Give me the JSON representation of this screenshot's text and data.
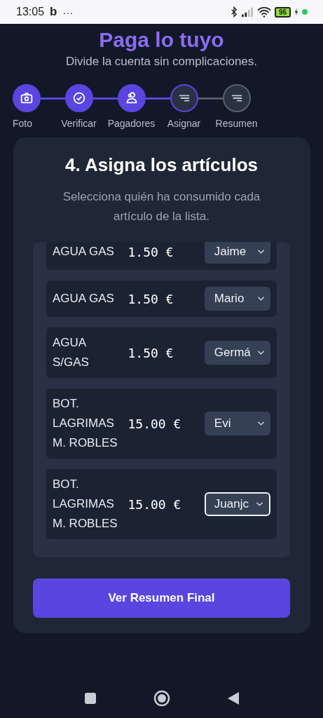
{
  "status_bar": {
    "time": "13:05",
    "app_letter": "b",
    "more": "···",
    "battery": "96"
  },
  "app": {
    "title": "Paga lo tuyo",
    "subtitle": "Divide la cuenta sin complicaciones."
  },
  "steps": [
    {
      "label": "Foto",
      "completed": true,
      "selected": false,
      "kind": "camera"
    },
    {
      "label": "Verificar",
      "completed": true,
      "selected": false,
      "kind": "check"
    },
    {
      "label": "Pagadores",
      "completed": true,
      "selected": false,
      "kind": "people"
    },
    {
      "label": "Asignar",
      "completed": false,
      "selected": true,
      "kind": "lines"
    },
    {
      "label": "Resumen",
      "completed": false,
      "selected": false,
      "kind": "lines"
    }
  ],
  "card": {
    "heading": "4. Asigna los artículos",
    "description": "Selecciona quién ha consumido cada artículo de la lista.",
    "items": [
      {
        "name": "AGUA GAS",
        "price": "1.50 €",
        "payer": "Jaime",
        "focused": false
      },
      {
        "name": "AGUA GAS",
        "price": "1.50 €",
        "payer": "Mario",
        "focused": false
      },
      {
        "name": "AGUA S/GAS",
        "price": "1.50 €",
        "payer": "Germá",
        "focused": false
      },
      {
        "name": "BOT. LAGRIMAS M. ROBLES",
        "price": "15.00 €",
        "payer": "Evi",
        "focused": false
      },
      {
        "name": "BOT. LAGRIMAS M. ROBLES",
        "price": "15.00 €",
        "payer": "Juanjc",
        "focused": true
      }
    ],
    "button": "Ver Resumen Final"
  }
}
